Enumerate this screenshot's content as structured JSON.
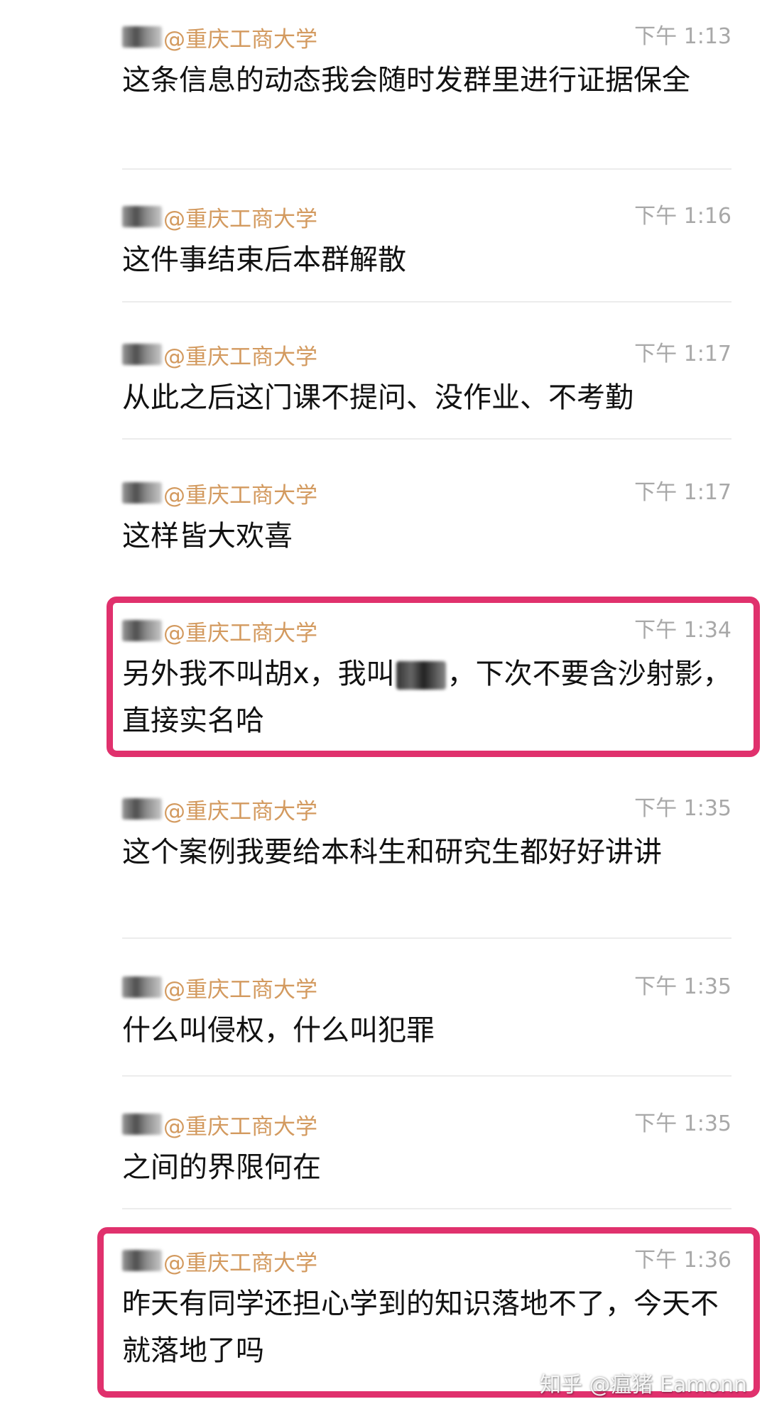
{
  "messages": [
    {
      "sender": "@重庆工商大学",
      "time": "下午 1:13",
      "text": "这条信息的动态我会随时发群里进行证据保全"
    },
    {
      "sender": "@重庆工商大学",
      "time": "下午 1:16",
      "text": "这件事结束后本群解散"
    },
    {
      "sender": "@重庆工商大学",
      "time": "下午 1:17",
      "text": "从此之后这门课不提问、没作业、不考勤"
    },
    {
      "sender": "@重庆工商大学",
      "time": "下午 1:17",
      "text": "这样皆大欢喜"
    },
    {
      "sender": "@重庆工商大学",
      "time": "下午 1:34",
      "text_before": "另外我不叫胡x，我叫",
      "text_after": "，下次不要含沙射影，直接实名哈"
    },
    {
      "sender": "@重庆工商大学",
      "time": "下午 1:35",
      "text": "这个案例我要给本科生和研究生都好好讲讲"
    },
    {
      "sender": "@重庆工商大学",
      "time": "下午 1:35",
      "text": "什么叫侵权，什么叫犯罪"
    },
    {
      "sender": "@重庆工商大学",
      "time": "下午 1:35",
      "text": "之间的界限何在"
    },
    {
      "sender": "@重庆工商大学",
      "time": "下午 1:36",
      "text": "昨天有同学还担心学到的知识落地不了，今天不就落地了吗"
    }
  ],
  "watermark": "知乎 @瘟猪 Eamonn",
  "colors": {
    "sender": "#d39a5f",
    "time": "#a8a8a8",
    "highlight_border": "#e0316d"
  }
}
